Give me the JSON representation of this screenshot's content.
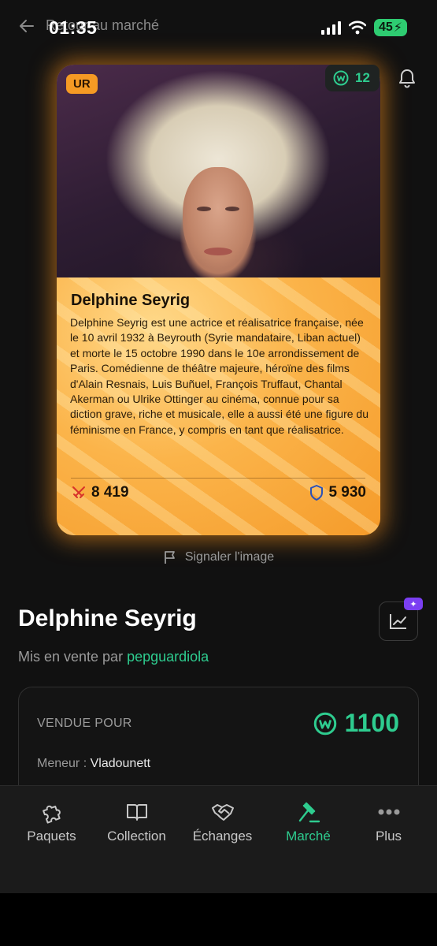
{
  "status_bar": {
    "time": "01:35",
    "battery": "45"
  },
  "header": {
    "back_label": "Retour au marché"
  },
  "card": {
    "rarity": "UR",
    "name": "Delphine Seyrig",
    "description": "Delphine Seyrig est une actrice et réalisatrice française, née le 10 avril 1932 à Beyrouth (Syrie mandataire, Liban actuel) et morte le 15 octobre 1990 dans le 10e arrondissement de Paris. Comédienne de théâtre majeure, héroïne des films d'Alain Resnais, Luis Buñuel, François Truffaut, Chantal Akerman ou Ulrike Ottinger au cinéma, connue pour sa diction grave, riche et musicale, elle a aussi été une figure du féminisme en France, y compris en tant que réalisatrice.",
    "attack": "8 419",
    "defense": "5 930",
    "portrait_alt": "Delphine Seyrig"
  },
  "wcoin_count": "12",
  "report_label": "Signaler l'image",
  "listing": {
    "title": "Delphine Seyrig",
    "seller_prefix": "Mis en vente par",
    "seller_name": "pepguardiola",
    "sold_label": "VENDUE POUR",
    "price": "1100",
    "leader_label": "Meneur :",
    "leader_name": "Vladounett"
  },
  "nav": {
    "items": [
      {
        "label": "Paquets",
        "icon": "puzzle-icon"
      },
      {
        "label": "Collection",
        "icon": "book-icon"
      },
      {
        "label": "Échanges",
        "icon": "handshake-icon"
      },
      {
        "label": "Marché",
        "icon": "gavel-icon"
      },
      {
        "label": "Plus",
        "icon": "more-icon"
      }
    ],
    "active_index": 3
  },
  "colors": {
    "accent": "#2ecc8f",
    "card_orange": "#f5a52e",
    "badge_orange": "#f59a24",
    "background": "#111111"
  }
}
